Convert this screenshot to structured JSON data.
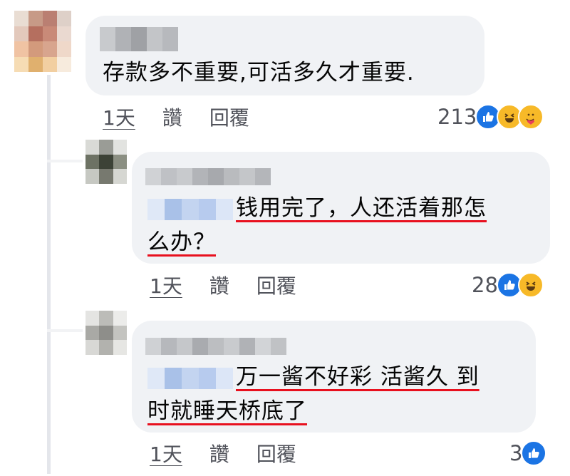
{
  "comments": [
    {
      "text": "存款多不重要,可活多久才重要.",
      "time": "1天",
      "like_label": "讚",
      "reply_label": "回覆",
      "reaction_count": "213",
      "reactions": [
        "like-icon",
        "haha-icon",
        "care-icon"
      ]
    },
    {
      "text_line1": "钱用完了，人还活着那怎",
      "text_line2": "么办？",
      "time": "1天",
      "like_label": "讚",
      "reply_label": "回覆",
      "reaction_count": "28",
      "reactions": [
        "like-icon",
        "haha-icon"
      ]
    },
    {
      "text_line1": "万一酱不好彩 活酱久 到",
      "text_line2": "时就睡天桥底了",
      "time": "1天",
      "like_label": "讚",
      "reply_label": "回覆",
      "reaction_count": "3",
      "reactions": [
        "like-icon"
      ]
    }
  ],
  "colors": {
    "bubble": "#f0f2f5",
    "underline": "#e8101e",
    "like": "#1b74e4",
    "haha": "#f7b928",
    "meta_text": "#50525a"
  }
}
